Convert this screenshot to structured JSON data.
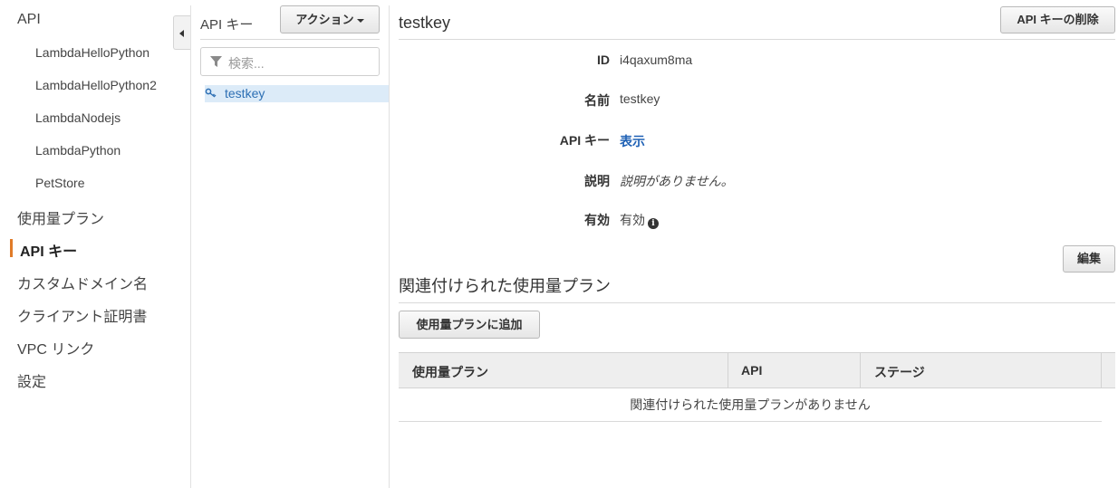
{
  "nav": {
    "api_label": "API",
    "apis": [
      "LambdaHelloPython",
      "LambdaHelloPython2",
      "LambdaNodejs",
      "LambdaPython",
      "PetStore"
    ],
    "usage_plans": "使用量プラン",
    "api_keys": "API キー",
    "custom_domains": "カスタムドメイン名",
    "client_certs": "クライアント証明書",
    "vpc_links": "VPC リンク",
    "settings": "設定",
    "active_accent": "#e07b28"
  },
  "keys_panel": {
    "title": "API キー",
    "actions_label": "アクション",
    "search_placeholder": "検索...",
    "selected_key": "testkey"
  },
  "detail": {
    "title": "testkey",
    "delete_label": "API キーの削除",
    "fields": {
      "id_label": "ID",
      "id_value": "i4qaxum8ma",
      "name_label": "名前",
      "name_value": "testkey",
      "key_label": "API キー",
      "key_value": "表示",
      "desc_label": "説明",
      "desc_value": "説明がありません。",
      "enabled_label": "有効",
      "enabled_value": "有効"
    },
    "edit_label": "編集",
    "plans_title": "関連付けられた使用量プラン",
    "add_plan_label": "使用量プランに追加",
    "table": {
      "columns": [
        "使用量プラン",
        "API",
        "ステージ"
      ],
      "empty_text": "関連付けられた使用量プランがありません"
    }
  }
}
